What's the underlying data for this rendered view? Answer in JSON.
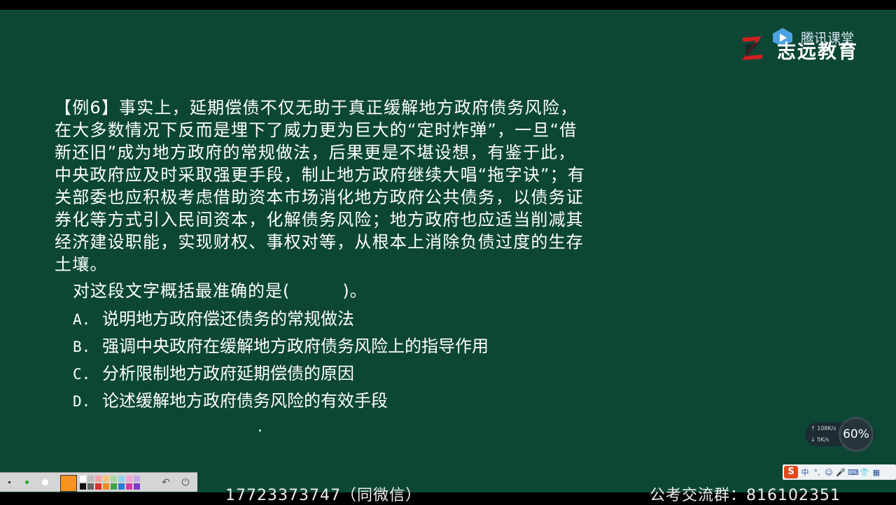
{
  "logo": {
    "brand_name": "志远教育",
    "platform_name": "腾讯课堂",
    "icons": [
      "zhiyuan-logo-icon",
      "tencent-classroom-icon"
    ]
  },
  "question": {
    "text": "【例6】事实上，延期偿债不仅无助于真正缓解地方政府债务风险，在大多数情况下反而是埋下了威力更为巨大的“定时炸弹”，一旦“借新还旧”成为地方政府的常规做法，后果更是不堪设想，有鉴于此，中央政府应及时采取强更手段，制止地方政府继续大唱“拖字诀”；有关部委也应积极考虑借助资本市场消化地方政府公共债务，以债务证券化等方式引入民间资本，化解债务风险；地方政府也应适当削减其经济建设职能，实现财权、事权对等，从根本上消除负债过度的生存土壤。",
    "prompt": "对这段文字概括最准确的是(　　　)。",
    "options": [
      {
        "letter": "A.",
        "text": "说明地方政府偿还债务的常规做法"
      },
      {
        "letter": "B.",
        "text": "强调中央政府在缓解地方政府债务风险上的指导作用"
      },
      {
        "letter": "C.",
        "text": "分析限制地方政府延期偿债的原因"
      },
      {
        "letter": "D.",
        "text": "论述缓解地方政府债务风险的有效手段"
      }
    ]
  },
  "net_widget": {
    "upload": "108K/s",
    "download": "5K/s",
    "percent": "60%"
  },
  "ime": {
    "logo": "S",
    "items": [
      "中",
      "°,",
      "☺",
      "🎤",
      "⌨",
      "👕",
      "▦"
    ]
  },
  "pen_toolbar": {
    "swatch_colors": [
      "#ffffff",
      "#bbbbbb",
      "#f4a6a6",
      "#f7c27a",
      "#a8d8a0",
      "#8fd3e8",
      "#f3a6d6",
      "#c8a8e8",
      "#111111",
      "#666666",
      "#e03030",
      "#f08a20",
      "#3aa64a",
      "#2a7ad8",
      "#d838a0",
      "#7a3ac8"
    ],
    "active_color": "#f7931e",
    "icons": [
      "undo-icon",
      "power-icon"
    ]
  },
  "bottom_text": {
    "left": "17723373747（同微信）",
    "right": "公考交流群：816102351"
  },
  "colors": {
    "board": "#0c4735",
    "text": "#ffffff"
  }
}
